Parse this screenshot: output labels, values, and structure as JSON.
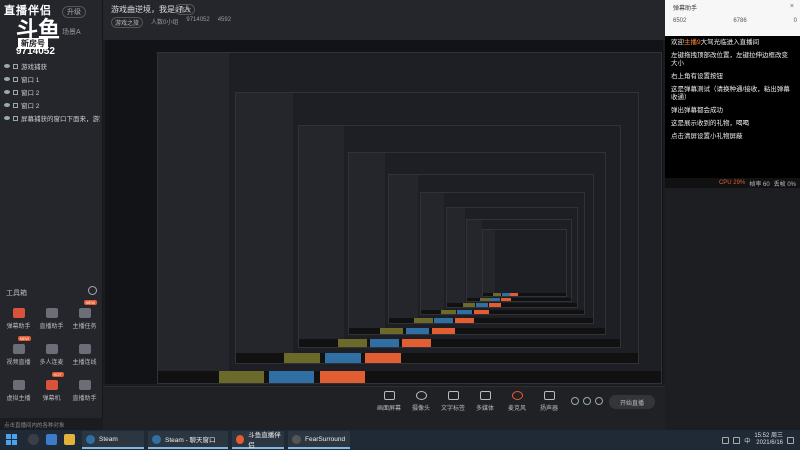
{
  "app": {
    "logo_top": "直播伴侣",
    "logo_big": "斗鱼",
    "logo_badge": "新房号",
    "room_id": "9714052",
    "version_badge": "升级",
    "scenes_label": "场景A"
  },
  "sources": [
    {
      "label": "游戏捕获"
    },
    {
      "label": "窗口 1"
    },
    {
      "label": "窗口 2"
    },
    {
      "label": "窗口 2"
    },
    {
      "label": "屏幕捕获的窗口下面来，游戏"
    }
  ],
  "toolbox": {
    "title": "工具箱",
    "items": [
      {
        "label": "弹幕助手",
        "color": "red",
        "badge": ""
      },
      {
        "label": "直播助手",
        "color": "grey",
        "badge": ""
      },
      {
        "label": "主播任务",
        "color": "grey",
        "badge": "NEW"
      },
      {
        "label": "视频直播",
        "color": "grey",
        "badge": "NEW"
      },
      {
        "label": "多人连麦",
        "color": "grey",
        "badge": ""
      },
      {
        "label": "主播连线",
        "color": "grey",
        "badge": ""
      },
      {
        "label": "虚拟主播",
        "color": "grey",
        "badge": ""
      },
      {
        "label": "弹幕机",
        "color": "red",
        "badge": "HOT"
      },
      {
        "label": "直播助手",
        "color": "grey",
        "badge": ""
      }
    ]
  },
  "header": {
    "title": "游戏曲逆境，我是好人",
    "edit": "修改",
    "category": "游戏之旅",
    "fans": "人数0小组",
    "room": "9714052",
    "likes": "4592"
  },
  "controls": [
    {
      "label": "画面屏幕",
      "key": "screen"
    },
    {
      "label": "摄像头",
      "key": "camera"
    },
    {
      "label": "文字标签",
      "key": "text"
    },
    {
      "label": "多媒体",
      "key": "media"
    },
    {
      "label": "麦克风",
      "key": "mic"
    },
    {
      "label": "扬声器",
      "key": "speaker"
    }
  ],
  "start_live": "开始直播",
  "right_panel": {
    "name": "弹幕助手",
    "stat1": "6502",
    "stat2": "6786",
    "stat3": "0",
    "chat": [
      {
        "text": "欢迎",
        "highlight": "主播9",
        "rest": "大驾光临进入直播间"
      },
      {
        "text": "左键拖拽顶部改位置，左键拉伸边框改变大小"
      },
      {
        "text": "右上角有设置按钮"
      },
      {
        "text": "这是弹幕测试（请换种通/接收，粘出弹幕收通）"
      },
      {
        "text": "弹出弹幕都会成功"
      },
      {
        "text": "这是展示收到的礼物，喝喝"
      },
      {
        "text": "点击清屏设置小礼物屏蔽"
      }
    ],
    "status_cpu": "CPU 29%",
    "status_fps": "帧率 60",
    "status_other": "丢帧 0%"
  },
  "status_strip": "点击直播间内的各种对象",
  "taskbar": {
    "tasks": [
      {
        "label": "Steam",
        "color": "#2f6fa3"
      },
      {
        "label": "Steam - 聊天窗口",
        "color": "#2f6fa3"
      },
      {
        "label": "斗鱼直播伴侣",
        "color": "#e35d33"
      },
      {
        "label": "FearSurround",
        "color": "#555555"
      }
    ],
    "time": "15:52 周三",
    "date": "2021/6/16",
    "lang": "中"
  }
}
